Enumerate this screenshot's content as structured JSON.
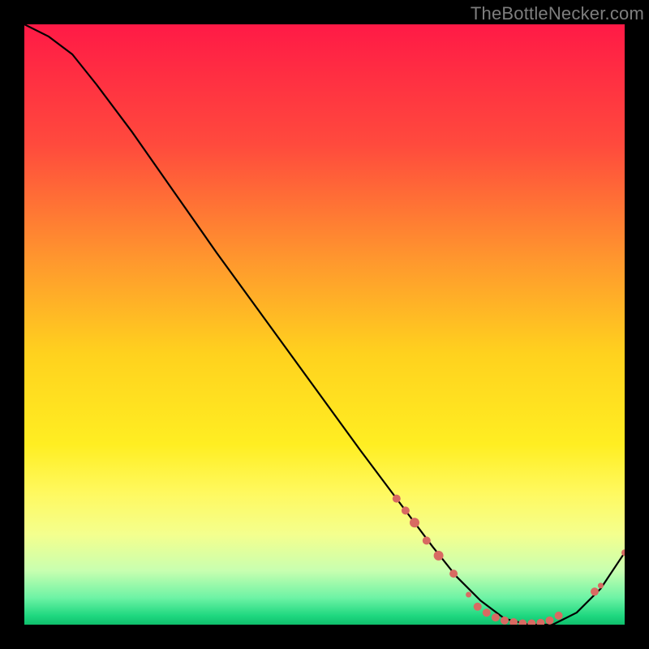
{
  "watermark": "TheBottleNecker.com",
  "chart_data": {
    "type": "line",
    "title": "",
    "xlabel": "",
    "ylabel": "",
    "xlim": [
      0,
      100
    ],
    "ylim": [
      0,
      100
    ],
    "grid": false,
    "series": [
      {
        "name": "curve",
        "x": [
          0,
          4,
          8,
          12,
          18,
          25,
          32,
          40,
          48,
          56,
          62,
          68,
          72,
          76,
          80,
          84,
          88,
          92,
          96,
          100
        ],
        "y": [
          100,
          98,
          95,
          90,
          82,
          72,
          62,
          51,
          40,
          29,
          21,
          13,
          8,
          4,
          1,
          0,
          0,
          2,
          6,
          12
        ]
      }
    ],
    "markers": [
      {
        "x": 62,
        "y": 21,
        "r": 5
      },
      {
        "x": 63.5,
        "y": 19,
        "r": 5
      },
      {
        "x": 65,
        "y": 17,
        "r": 6
      },
      {
        "x": 67,
        "y": 14,
        "r": 5
      },
      {
        "x": 69,
        "y": 11.5,
        "r": 6
      },
      {
        "x": 71.5,
        "y": 8.5,
        "r": 5
      },
      {
        "x": 74,
        "y": 5,
        "r": 3.5
      },
      {
        "x": 75.5,
        "y": 3,
        "r": 5
      },
      {
        "x": 77,
        "y": 2,
        "r": 5
      },
      {
        "x": 78.5,
        "y": 1.2,
        "r": 5
      },
      {
        "x": 80,
        "y": 0.7,
        "r": 5
      },
      {
        "x": 81.5,
        "y": 0.4,
        "r": 5
      },
      {
        "x": 83,
        "y": 0.2,
        "r": 5
      },
      {
        "x": 84.5,
        "y": 0.2,
        "r": 5
      },
      {
        "x": 86,
        "y": 0.3,
        "r": 5
      },
      {
        "x": 87.5,
        "y": 0.7,
        "r": 5
      },
      {
        "x": 89,
        "y": 1.5,
        "r": 5
      },
      {
        "x": 95,
        "y": 5.5,
        "r": 5
      },
      {
        "x": 96,
        "y": 6.5,
        "r": 3.5
      },
      {
        "x": 100,
        "y": 12,
        "r": 4
      }
    ],
    "background_gradient": {
      "stops": [
        {
          "offset": 0.0,
          "color": "#ff1a46"
        },
        {
          "offset": 0.2,
          "color": "#ff4a3d"
        },
        {
          "offset": 0.4,
          "color": "#ff9a2d"
        },
        {
          "offset": 0.55,
          "color": "#ffd21e"
        },
        {
          "offset": 0.7,
          "color": "#ffee22"
        },
        {
          "offset": 0.78,
          "color": "#fff95f"
        },
        {
          "offset": 0.85,
          "color": "#f4ff8e"
        },
        {
          "offset": 0.91,
          "color": "#c8ffb0"
        },
        {
          "offset": 0.955,
          "color": "#6ef3a5"
        },
        {
          "offset": 0.985,
          "color": "#1fd880"
        },
        {
          "offset": 1.0,
          "color": "#0fbf6c"
        }
      ]
    },
    "marker_color": "#d86a62",
    "curve_color": "#000000"
  }
}
